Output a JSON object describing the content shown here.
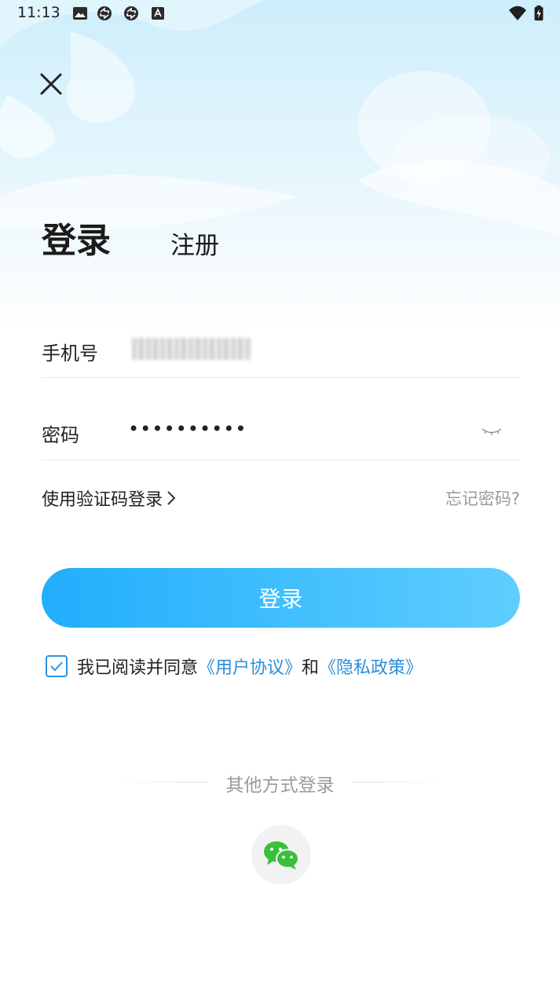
{
  "status_bar": {
    "time": "11:13",
    "icons": [
      "image-icon",
      "sync-icon",
      "sync-icon",
      "font-icon"
    ],
    "right_icons": [
      "wifi-icon",
      "battery-charging-icon"
    ]
  },
  "close_icon": "close-icon",
  "tabs": {
    "login": "登录",
    "register": "注册"
  },
  "form": {
    "phone_label": "手机号",
    "phone_value": "",
    "password_label": "密码",
    "password_value": "••••••••••",
    "eye_icon": "eye-closed-icon"
  },
  "links": {
    "sms_login": "使用验证码登录",
    "sms_chevron": "chevron-right-icon",
    "forgot_password": "忘记密码?"
  },
  "login_button": "登录",
  "agreement": {
    "checked": true,
    "prefix": "我已阅读并同意",
    "user_agreement": "《用户协议》",
    "and": "和",
    "privacy_policy": "《隐私政策》"
  },
  "other_login": {
    "label": "其他方式登录",
    "wechat_icon": "wechat-icon"
  },
  "colors": {
    "accent": "#21aefc",
    "link": "#2a8fd9",
    "wechat": "#39c039"
  }
}
